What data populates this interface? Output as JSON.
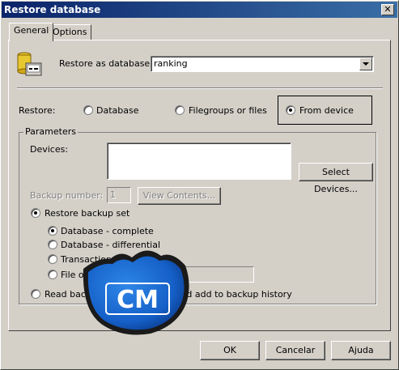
{
  "window": {
    "title": "Restore database",
    "close_glyph": "✕"
  },
  "tabs": [
    {
      "label": "General"
    },
    {
      "label": "Options"
    }
  ],
  "restore_as": {
    "label": "Restore as database:",
    "value": "ranking"
  },
  "restore": {
    "label": "Restore:",
    "options": [
      {
        "label": "Database",
        "checked": false
      },
      {
        "label": "Filegroups or files",
        "checked": false
      },
      {
        "label": "From device",
        "checked": true
      }
    ]
  },
  "parameters": {
    "caption": "Parameters",
    "devices_label": "Devices:",
    "select_devices_button": "Select Devices...",
    "backup_number_label": "Backup number:",
    "backup_number_value": "1",
    "view_contents_button": "View Contents...",
    "restore_backup_set_label": "Restore backup set",
    "backup_set_options": [
      {
        "label": "Database - complete",
        "checked": true
      },
      {
        "label": "Database - differential",
        "checked": false
      },
      {
        "label": "Transaction log",
        "checked": false
      },
      {
        "label": "File or filegroup",
        "checked": false
      }
    ],
    "read_backup_label": "Read backup set information and add to backup history"
  },
  "buttons": {
    "ok": "OK",
    "cancel": "Cancelar",
    "help": "Ajuda"
  },
  "watermark": {
    "text": "CM"
  },
  "colors": {
    "title_start": "#0a246a",
    "title_end": "#3a6ea5",
    "face": "#d4d0c8",
    "watermark_blue": "#1560c8"
  }
}
